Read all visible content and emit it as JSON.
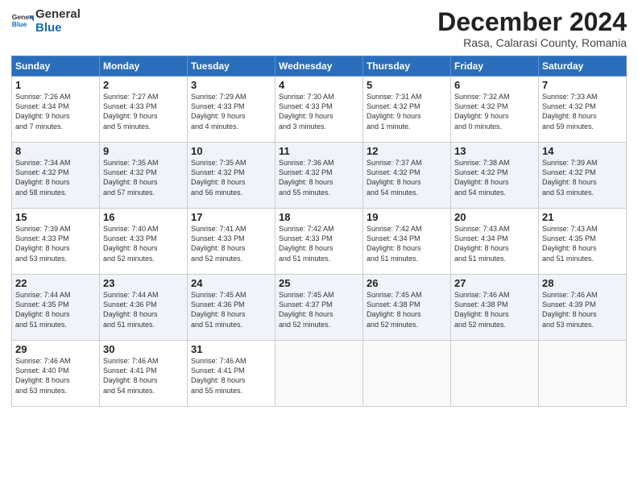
{
  "header": {
    "logo_line1": "General",
    "logo_line2": "Blue",
    "month": "December 2024",
    "location": "Rasa, Calarasi County, Romania"
  },
  "days_of_week": [
    "Sunday",
    "Monday",
    "Tuesday",
    "Wednesday",
    "Thursday",
    "Friday",
    "Saturday"
  ],
  "weeks": [
    [
      {
        "num": "1",
        "info": "Sunrise: 7:26 AM\nSunset: 4:34 PM\nDaylight: 9 hours\nand 7 minutes."
      },
      {
        "num": "2",
        "info": "Sunrise: 7:27 AM\nSunset: 4:33 PM\nDaylight: 9 hours\nand 5 minutes."
      },
      {
        "num": "3",
        "info": "Sunrise: 7:29 AM\nSunset: 4:33 PM\nDaylight: 9 hours\nand 4 minutes."
      },
      {
        "num": "4",
        "info": "Sunrise: 7:30 AM\nSunset: 4:33 PM\nDaylight: 9 hours\nand 3 minutes."
      },
      {
        "num": "5",
        "info": "Sunrise: 7:31 AM\nSunset: 4:32 PM\nDaylight: 9 hours\nand 1 minute."
      },
      {
        "num": "6",
        "info": "Sunrise: 7:32 AM\nSunset: 4:32 PM\nDaylight: 9 hours\nand 0 minutes."
      },
      {
        "num": "7",
        "info": "Sunrise: 7:33 AM\nSunset: 4:32 PM\nDaylight: 8 hours\nand 59 minutes."
      }
    ],
    [
      {
        "num": "8",
        "info": "Sunrise: 7:34 AM\nSunset: 4:32 PM\nDaylight: 8 hours\nand 58 minutes."
      },
      {
        "num": "9",
        "info": "Sunrise: 7:35 AM\nSunset: 4:32 PM\nDaylight: 8 hours\nand 57 minutes."
      },
      {
        "num": "10",
        "info": "Sunrise: 7:35 AM\nSunset: 4:32 PM\nDaylight: 8 hours\nand 56 minutes."
      },
      {
        "num": "11",
        "info": "Sunrise: 7:36 AM\nSunset: 4:32 PM\nDaylight: 8 hours\nand 55 minutes."
      },
      {
        "num": "12",
        "info": "Sunrise: 7:37 AM\nSunset: 4:32 PM\nDaylight: 8 hours\nand 54 minutes."
      },
      {
        "num": "13",
        "info": "Sunrise: 7:38 AM\nSunset: 4:32 PM\nDaylight: 8 hours\nand 54 minutes."
      },
      {
        "num": "14",
        "info": "Sunrise: 7:39 AM\nSunset: 4:32 PM\nDaylight: 8 hours\nand 53 minutes."
      }
    ],
    [
      {
        "num": "15",
        "info": "Sunrise: 7:39 AM\nSunset: 4:33 PM\nDaylight: 8 hours\nand 53 minutes."
      },
      {
        "num": "16",
        "info": "Sunrise: 7:40 AM\nSunset: 4:33 PM\nDaylight: 8 hours\nand 52 minutes."
      },
      {
        "num": "17",
        "info": "Sunrise: 7:41 AM\nSunset: 4:33 PM\nDaylight: 8 hours\nand 52 minutes."
      },
      {
        "num": "18",
        "info": "Sunrise: 7:42 AM\nSunset: 4:33 PM\nDaylight: 8 hours\nand 51 minutes."
      },
      {
        "num": "19",
        "info": "Sunrise: 7:42 AM\nSunset: 4:34 PM\nDaylight: 8 hours\nand 51 minutes."
      },
      {
        "num": "20",
        "info": "Sunrise: 7:43 AM\nSunset: 4:34 PM\nDaylight: 8 hours\nand 51 minutes."
      },
      {
        "num": "21",
        "info": "Sunrise: 7:43 AM\nSunset: 4:35 PM\nDaylight: 8 hours\nand 51 minutes."
      }
    ],
    [
      {
        "num": "22",
        "info": "Sunrise: 7:44 AM\nSunset: 4:35 PM\nDaylight: 8 hours\nand 51 minutes."
      },
      {
        "num": "23",
        "info": "Sunrise: 7:44 AM\nSunset: 4:36 PM\nDaylight: 8 hours\nand 51 minutes."
      },
      {
        "num": "24",
        "info": "Sunrise: 7:45 AM\nSunset: 4:36 PM\nDaylight: 8 hours\nand 51 minutes."
      },
      {
        "num": "25",
        "info": "Sunrise: 7:45 AM\nSunset: 4:37 PM\nDaylight: 8 hours\nand 52 minutes."
      },
      {
        "num": "26",
        "info": "Sunrise: 7:45 AM\nSunset: 4:38 PM\nDaylight: 8 hours\nand 52 minutes."
      },
      {
        "num": "27",
        "info": "Sunrise: 7:46 AM\nSunset: 4:38 PM\nDaylight: 8 hours\nand 52 minutes."
      },
      {
        "num": "28",
        "info": "Sunrise: 7:46 AM\nSunset: 4:39 PM\nDaylight: 8 hours\nand 53 minutes."
      }
    ],
    [
      {
        "num": "29",
        "info": "Sunrise: 7:46 AM\nSunset: 4:40 PM\nDaylight: 8 hours\nand 53 minutes."
      },
      {
        "num": "30",
        "info": "Sunrise: 7:46 AM\nSunset: 4:41 PM\nDaylight: 8 hours\nand 54 minutes."
      },
      {
        "num": "31",
        "info": "Sunrise: 7:46 AM\nSunset: 4:41 PM\nDaylight: 8 hours\nand 55 minutes."
      },
      {
        "num": "",
        "info": ""
      },
      {
        "num": "",
        "info": ""
      },
      {
        "num": "",
        "info": ""
      },
      {
        "num": "",
        "info": ""
      }
    ]
  ]
}
